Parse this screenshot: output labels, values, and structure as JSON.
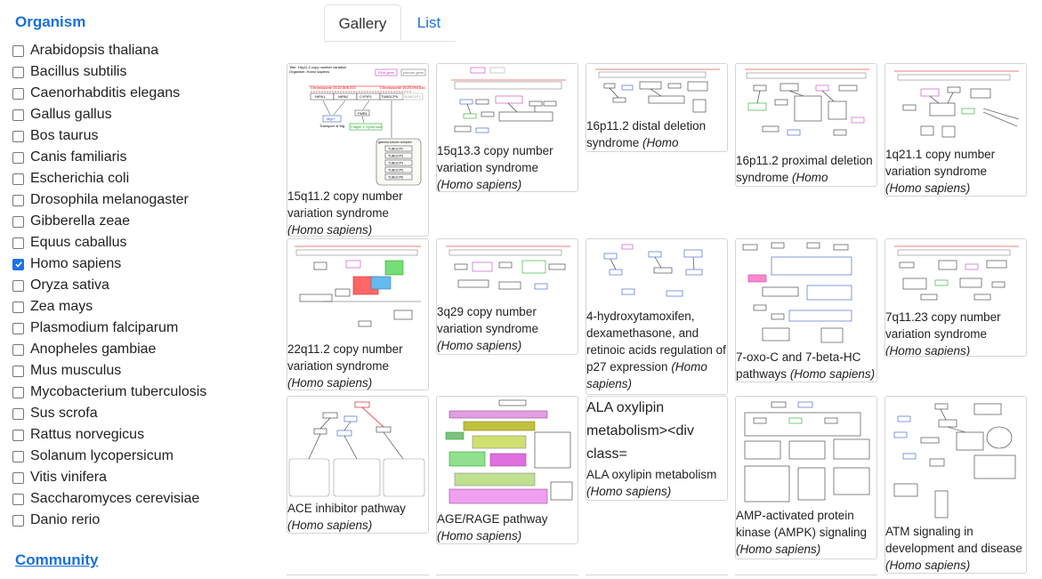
{
  "sidebar": {
    "organism_heading": "Organism",
    "community_heading": "Community",
    "organisms": [
      {
        "label": "Arabidopsis thaliana",
        "checked": false
      },
      {
        "label": "Bacillus subtilis",
        "checked": false
      },
      {
        "label": "Caenorhabditis elegans",
        "checked": false
      },
      {
        "label": "Gallus gallus",
        "checked": false
      },
      {
        "label": "Bos taurus",
        "checked": false
      },
      {
        "label": "Canis familiaris",
        "checked": false
      },
      {
        "label": "Escherichia coli",
        "checked": false
      },
      {
        "label": "Drosophila melanogaster",
        "checked": false
      },
      {
        "label": "Gibberella zeae",
        "checked": false
      },
      {
        "label": "Equus caballus",
        "checked": false
      },
      {
        "label": "Homo sapiens",
        "checked": true
      },
      {
        "label": "Oryza sativa",
        "checked": false
      },
      {
        "label": "Zea mays",
        "checked": false
      },
      {
        "label": "Plasmodium falciparum",
        "checked": false
      },
      {
        "label": "Anopheles gambiae",
        "checked": false
      },
      {
        "label": "Mus musculus",
        "checked": false
      },
      {
        "label": "Mycobacterium tuberculosis",
        "checked": false
      },
      {
        "label": "Sus scrofa",
        "checked": false
      },
      {
        "label": "Rattus norvegicus",
        "checked": false
      },
      {
        "label": "Solanum lycopersicum",
        "checked": false
      },
      {
        "label": "Vitis vinifera",
        "checked": false
      },
      {
        "label": "Saccharomyces cerevisiae",
        "checked": false
      },
      {
        "label": "Danio rerio",
        "checked": false
      }
    ]
  },
  "tabs": {
    "gallery": "Gallery",
    "list": "List"
  },
  "cards": [
    {
      "title": "15q11.2 copy number variation syndrome",
      "species": "(Homo sapiens)"
    },
    {
      "title": "15q13.3 copy number variation syndrome",
      "species": "(Homo sapiens)"
    },
    {
      "title": "16p11.2 distal deletion syndrome",
      "species": "(Homo sapiens)"
    },
    {
      "title": "16p11.2 proximal deletion syndrome",
      "species": "(Homo sapiens)"
    },
    {
      "title": "1q21.1 copy number variation syndrome",
      "species": "(Homo sapiens)"
    },
    {
      "title": "22q11.2 copy number variation syndrome",
      "species": "(Homo sapiens)"
    },
    {
      "title": "3q29 copy number variation syndrome",
      "species": "(Homo sapiens)"
    },
    {
      "title": "4-hydroxytamoxifen, dexamethasone, and retinoic acids regulation of p27 expression",
      "species": "(Homo sapiens)"
    },
    {
      "title": "7-oxo-C and 7-beta-HC pathways",
      "species": "(Homo sapiens)"
    },
    {
      "title": "7q11.23 copy number variation syndrome",
      "species": "(Homo sapiens)"
    },
    {
      "title": "ACE inhibitor pathway",
      "species": "(Homo sapiens)"
    },
    {
      "title": "AGE/RAGE pathway",
      "species": "(Homo sapiens)"
    },
    {
      "broken_heading": "ALA oxylipin metabolism><div class=",
      "title": "ALA oxylipin metabolism",
      "species": "(Homo sapiens)"
    },
    {
      "title": "AMP-activated protein kinase (AMPK) signaling",
      "species": "(Homo sapiens)"
    },
    {
      "title": "ATM signaling in development and disease",
      "species": "(Homo sapiens)"
    }
  ],
  "thumb_texts": {
    "card0": {
      "title_line": "Title: 15q11.2 copy number variation",
      "organism_line": "Organism: Homo sapiens",
      "rna_gene": "RNA gene",
      "pseudo_gene": "pseudo gene",
      "chrom_a": "Chromosome 15:22,805,313",
      "chrom_b": "Chromosome 15:23,094,530",
      "genes": [
        "NIPA1",
        "NIPA2",
        "CYFIP1",
        "TUBGCP5"
      ],
      "ghost_gene": "SLMO1P1",
      "mg": "Mg2+",
      "transport": "Transport of Mg",
      "fmr1": "FMR1",
      "fragile": "Fragile X Syndrome",
      "complex": "gamma tubulin complex",
      "tubgcp": [
        "TUBGCP2",
        "TUBGCP3",
        "TUBGCP4",
        "TUBGCP5",
        "TUBGCP6"
      ]
    }
  }
}
